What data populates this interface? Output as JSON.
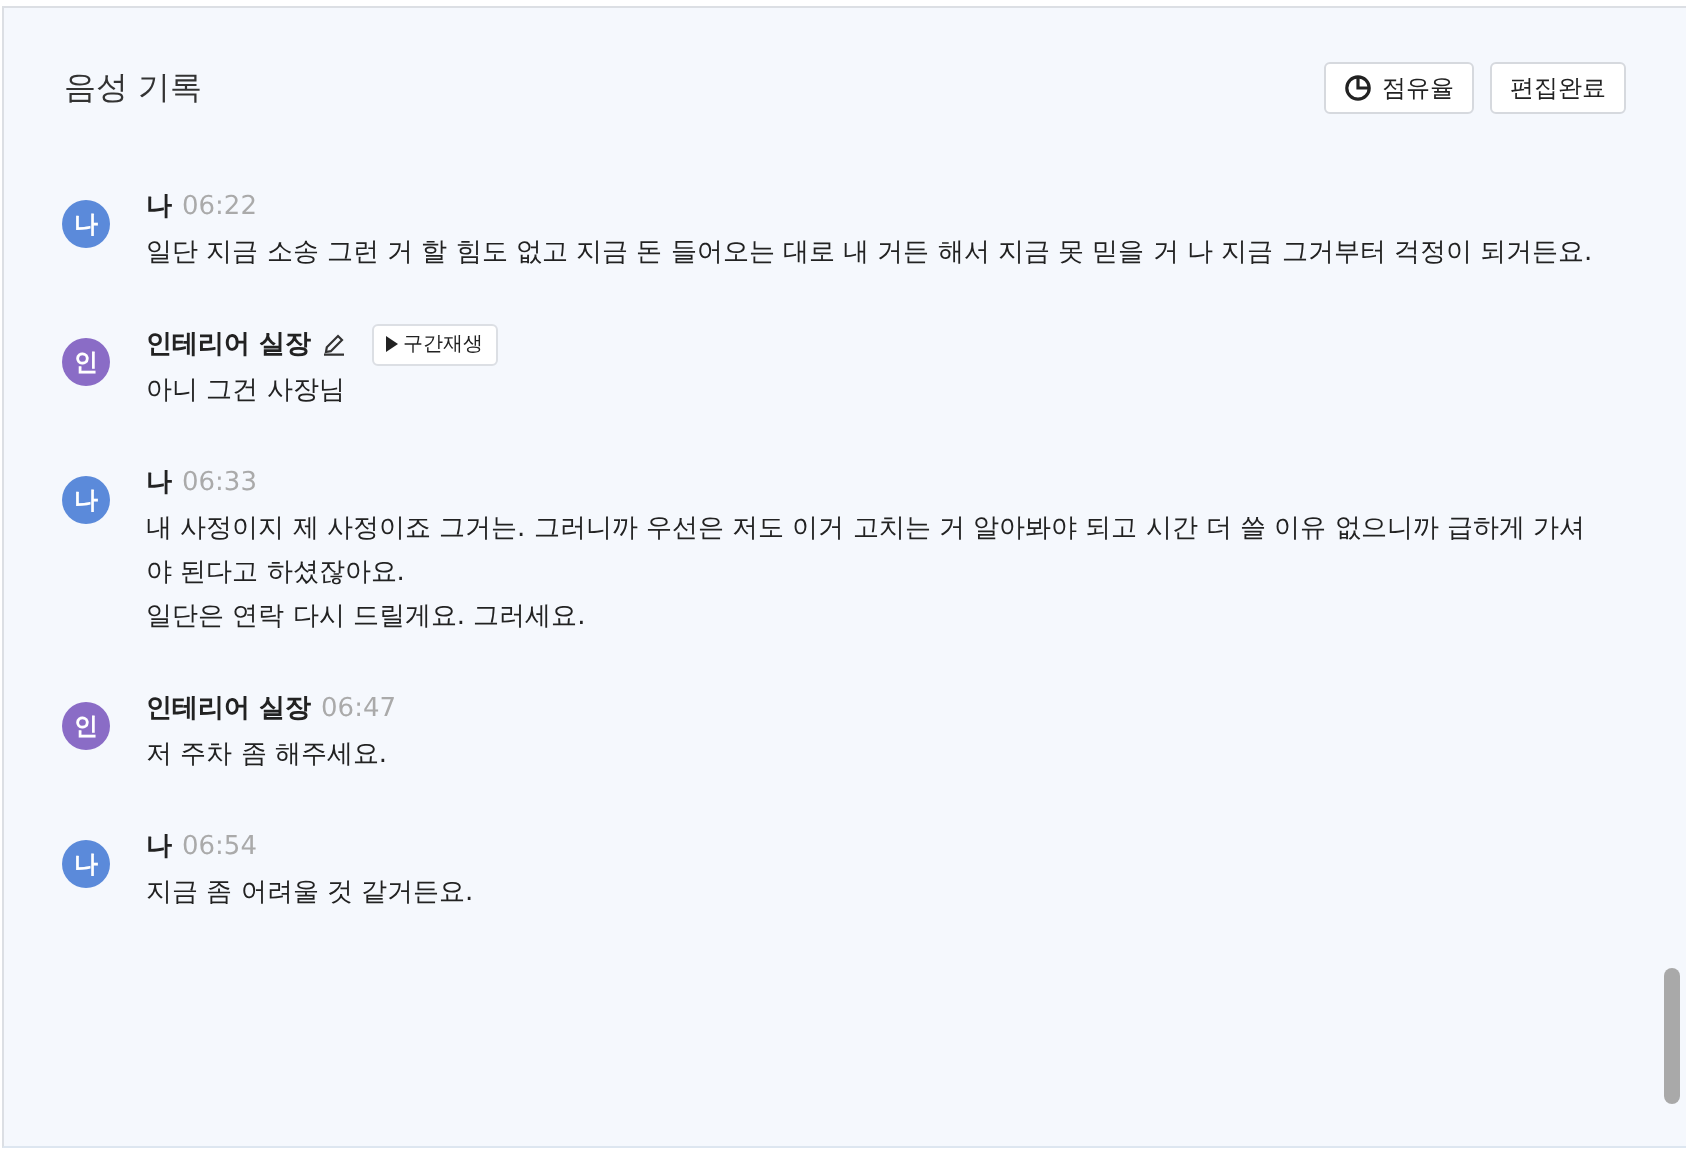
{
  "title": "음성 기록",
  "buttons": [
    {
      "kind": "share",
      "label": "점유율"
    },
    {
      "kind": "plain",
      "label": "편집완료"
    }
  ],
  "entries": [
    {
      "avatar": "나",
      "color": "#5b8ada",
      "speaker": "나",
      "time": "06:22",
      "editing": false,
      "lines": [
        "일단 지금 소송 그런 거 할 힘도 없고 지금 돈 들어오는 대로 내 거든 해서 지금 못 믿을 거 나 지금 그거부터 걱정이 되거든요."
      ]
    },
    {
      "avatar": "인",
      "color": "#8a6cc6",
      "speaker": "인테리어 실장",
      "editing": true,
      "replay": "구간재생",
      "lines": [
        "아니 그건 사장님"
      ]
    },
    {
      "avatar": "나",
      "color": "#5b8ada",
      "speaker": "나",
      "time": "06:33",
      "editing": false,
      "lines": [
        "내 사정이지 제 사정이죠 그거는. 그러니까 우선은 저도 이거 고치는 거 알아봐야 되고 시간 더 쓸 이유 없으니까 급하게 가셔야 된다고 하셨잖아요.",
        "일단은 연락 다시 드릴게요. 그러세요."
      ]
    },
    {
      "avatar": "인",
      "color": "#8a6cc6",
      "speaker": "인테리어 실장",
      "time": "06:47",
      "editing": false,
      "lines": [
        "저 주차 좀 해주세요."
      ]
    },
    {
      "avatar": "나",
      "color": "#5b8ada",
      "speaker": "나",
      "time": "06:54",
      "editing": false,
      "lines": [
        "지금 좀 어려울 것 같거든요."
      ]
    }
  ]
}
